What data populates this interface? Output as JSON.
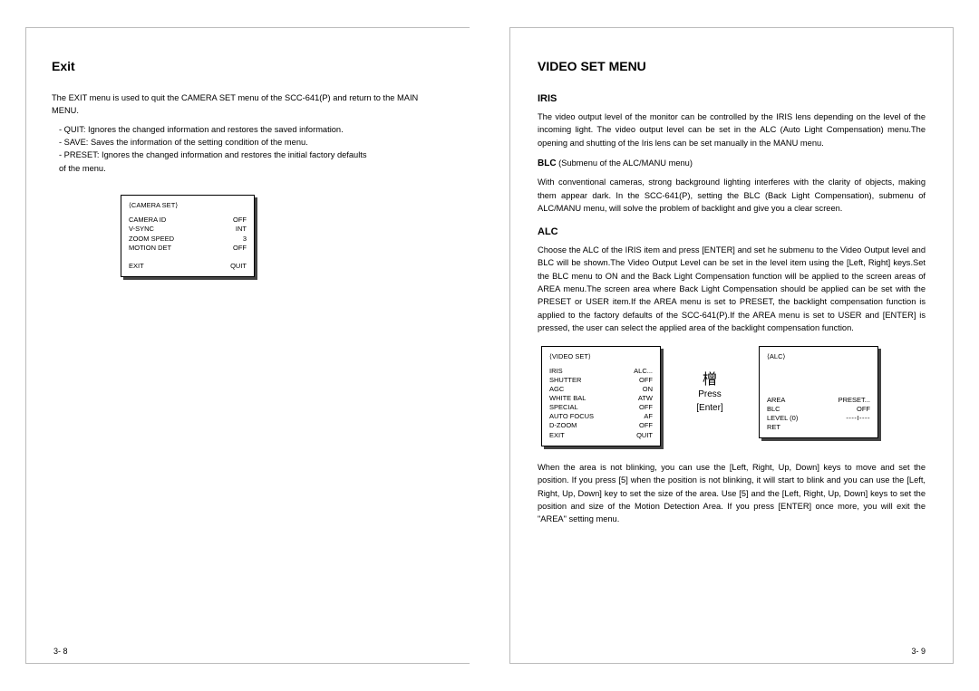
{
  "left": {
    "title": "Exit",
    "intro": "The EXIT menu is used to quit the CAMERA SET menu of the SCC-641(P) and return to the MAIN MENU.",
    "bullets": [
      "- QUIT: Ignores the changed information and restores the saved information.",
      "- SAVE: Saves the information of the setting condition of the menu.",
      "- PRESET: Ignores the changed information and restores the initial factory defaults",
      "  of the menu."
    ],
    "menu": {
      "header": "⟨CAMERA SET⟩",
      "rows": [
        {
          "lbl": "CAMERA ID",
          "val": "OFF"
        },
        {
          "lbl": "V-SYNC",
          "val": "INT"
        },
        {
          "lbl": "ZOOM SPEED",
          "val": "3"
        },
        {
          "lbl": "MOTION DET",
          "val": "OFF"
        }
      ],
      "exit": {
        "lbl": "EXIT",
        "val": "QUIT"
      }
    },
    "pagenum": "3- 8"
  },
  "right": {
    "title": "VIDEO SET MENU",
    "iris_h": "IRIS",
    "iris_p": "The video output level of the monitor can be controlled by the IRIS lens depending on the level of the incoming light. The video output level can be set in the ALC (Auto Light Compensation) menu.The opening and shutting of the Iris lens can be set manually in the MANU menu.",
    "blc_h": "BLC",
    "blc_sub": " (Submenu of the ALC/MANU menu)",
    "blc_p": "With conventional cameras, strong background lighting interferes with the clarity of objects, making them appear dark.  In the SCC-641(P), setting the BLC (Back Light Compensation), submenu of ALC/MANU menu, will solve the problem of backlight and give you a clear screen.",
    "alc_h": "ALC",
    "alc_p": "Choose the ALC of the IRIS item and press [ENTER] and set he submenu to the Video Output level and BLC will be shown.The Video Output Level can be set in the level item using the [Left, Right] keys.Set the BLC menu to ON and the Back Light Compensation function will be applied to the screen areas of AREA menu.The screen area where Back Light Compensation should be applied can be set with the PRESET or USER item.If the AREA menu is set to PRESET, the backlight compensation function is applied to the factory defaults of the SCC-641(P).If the AREA menu is set to USER and [ENTER] is pressed, the user can select the applied area of the backlight compensation function.",
    "videoset": {
      "header": "⟨VIDEO SET⟩",
      "rows": [
        {
          "lbl": "IRIS",
          "val": "ALC..."
        },
        {
          "lbl": "SHUTTER",
          "val": "OFF"
        },
        {
          "lbl": "AGC",
          "val": "ON"
        },
        {
          "lbl": "WHITE BAL",
          "val": "ATW"
        },
        {
          "lbl": "SPECIAL",
          "val": "OFF"
        },
        {
          "lbl": "AUTO FOCUS",
          "val": "AF"
        },
        {
          "lbl": "D-ZOOM",
          "val": "OFF"
        },
        {
          "lbl": "EXIT",
          "val": "QUIT"
        }
      ]
    },
    "arrow": {
      "sym": "橧",
      "l1": "Press",
      "l2": "[Enter]"
    },
    "alcmenu": {
      "header": "⟨ALC⟩",
      "rows": [
        {
          "lbl": "AREA",
          "val": "PRESET..."
        },
        {
          "lbl": "BLC",
          "val": "OFF"
        },
        {
          "lbl": "LEVEL (0)",
          "val": "----I----"
        },
        {
          "lbl": "RET",
          "val": ""
        }
      ]
    },
    "tail": "When the area is not blinking, you can use the [Left, Right, Up, Down] keys to move and set the position.  If you press [5] when the position is not blinking, it will start to blink and you can use the [Left, Right, Up, Down] key to set the size of the area.  Use [5] and the [Left, Right, Up, Down] keys to set the position and size of the Motion Detection Area. If you press [ENTER] once more, you will exit the \"AREA\" setting menu.",
    "pagenum": "3- 9"
  }
}
